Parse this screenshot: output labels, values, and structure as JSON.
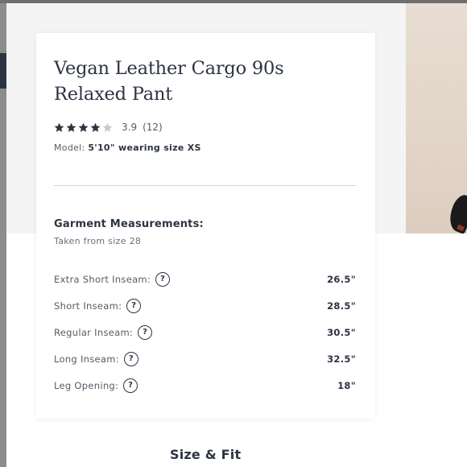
{
  "product": {
    "title": "Vegan Leather Cargo 90s Relaxed Pant",
    "rating": {
      "stars": 4,
      "max_stars": 5,
      "value": "3.9",
      "count": "(12)"
    },
    "model": {
      "prefix": "Model:",
      "detail": "5'10\" wearing size XS"
    }
  },
  "measurements": {
    "title": "Garment Measurements:",
    "subtitle": "Taken from size 28",
    "help_glyph": "?",
    "rows": [
      {
        "label": "Extra Short Inseam:",
        "value": "26.5\""
      },
      {
        "label": "Short Inseam:",
        "value": "28.5\""
      },
      {
        "label": "Regular Inseam:",
        "value": "30.5\""
      },
      {
        "label": "Long Inseam:",
        "value": "32.5\""
      },
      {
        "label": "Leg Opening:",
        "value": "18\""
      }
    ]
  },
  "section": {
    "size_fit": "Size & Fit"
  },
  "colors": {
    "text_primary": "#2c3442",
    "text_secondary": "#555b66",
    "star_filled": "#2c3442",
    "star_empty": "#c8cbd0",
    "backdrop": "#f4f4f4"
  },
  "icons": {
    "help": "question-circle-icon",
    "star": "star-icon"
  }
}
